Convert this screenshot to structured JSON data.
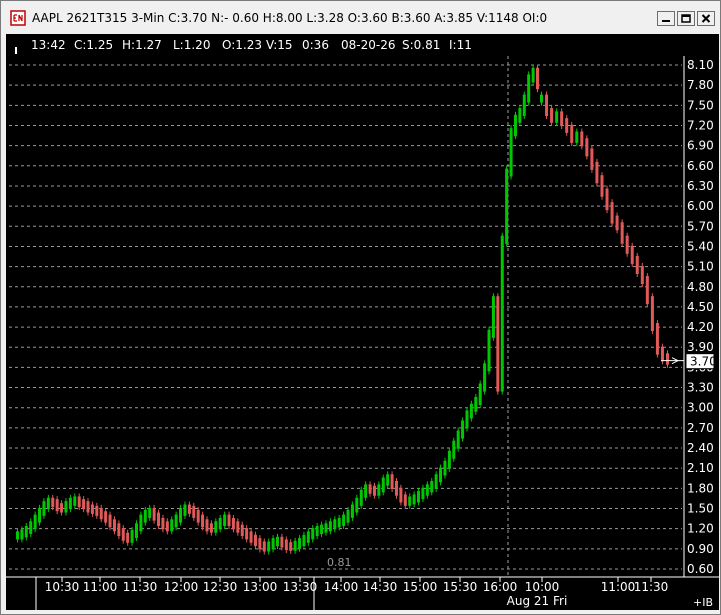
{
  "window": {
    "title": "AAPL 2621T315 3-Min C:3.70 N:- 0.60 H:8.00 L:3.28 O:3.60 B:3.60 A:3.85 V:1148 OI:0"
  },
  "infobar": {
    "time": "13:42",
    "close": "C:1.25",
    "high": "H:1.27",
    "low": "L:1.20",
    "open": "O:1.23",
    "volume": "V:15",
    "seconds": "0:36",
    "date": "08-20-26",
    "s": "S:0.81",
    "i": "I:11"
  },
  "chart_data": {
    "type": "candlestick",
    "y_ticks": [
      "8.10",
      "7.80",
      "7.50",
      "7.20",
      "6.90",
      "6.60",
      "6.30",
      "6.00",
      "5.70",
      "5.40",
      "5.10",
      "4.80",
      "4.50",
      "4.20",
      "3.90",
      "3.60",
      "3.30",
      "3.00",
      "2.70",
      "2.40",
      "2.10",
      "1.80",
      "1.50",
      "1.20",
      "0.90",
      "0.60"
    ],
    "ylim": [
      0.6,
      8.1
    ],
    "x_ticks": [
      "10:30",
      "11:00",
      "11:30",
      "12:00",
      "12:30",
      "13:00",
      "13:30",
      "14:00",
      "14:30",
      "15:00",
      "15:30",
      "16:00",
      "10:00",
      "11:00",
      "11:30"
    ],
    "day_label": "Aug 21 Fri",
    "last_price": "3.70",
    "cursor_value": "0.81",
    "footer_label": "+IB",
    "grid": true,
    "up_color": "#00c800",
    "down_color": "#e05a5a",
    "axis_text_color": "#ffffff",
    "grid_color": "#9a9a9a",
    "background_color": "#000000",
    "series": [
      {
        "session": "Aug 20",
        "values": [
          1.1,
          1.13,
          1.18,
          1.25,
          1.35,
          1.45,
          1.55,
          1.6,
          1.58,
          1.52,
          1.5,
          1.55,
          1.6,
          1.62,
          1.58,
          1.55,
          1.5,
          1.48,
          1.45,
          1.4,
          1.35,
          1.28,
          1.22,
          1.15,
          1.08,
          1.05,
          1.12,
          1.22,
          1.35,
          1.42,
          1.45,
          1.38,
          1.3,
          1.25,
          1.22,
          1.28,
          1.35,
          1.45,
          1.5,
          1.48,
          1.42,
          1.35,
          1.28,
          1.22,
          1.2,
          1.25,
          1.3,
          1.35,
          1.3,
          1.25,
          1.2,
          1.15,
          1.1,
          1.05,
          1.0,
          0.95,
          0.92,
          0.95,
          1.0,
          1.02,
          0.98,
          0.94,
          0.93,
          0.96,
          1.0,
          1.05,
          1.1,
          1.15,
          1.18,
          1.2,
          1.22,
          1.25,
          1.28,
          1.3,
          1.35,
          1.42,
          1.5,
          1.6,
          1.72,
          1.8,
          1.78,
          1.75,
          1.8,
          1.9,
          1.95,
          1.85,
          1.75,
          1.65,
          1.6,
          1.62,
          1.65,
          1.7,
          1.75,
          1.8,
          1.85,
          1.95,
          2.05,
          2.15,
          2.3,
          2.45,
          2.6,
          2.75,
          2.9,
          3.0,
          3.1,
          3.3,
          3.6,
          4.1,
          4.6,
          3.3,
          5.5,
          6.5,
          7.1,
          7.3,
          7.4,
          7.6,
          7.9,
          8.0,
          7.8
        ]
      },
      {
        "session": "Aug 21",
        "values": [
          7.6,
          7.4,
          7.3,
          7.35,
          7.25,
          7.15,
          7.0,
          7.05,
          6.95,
          6.8,
          6.6,
          6.4,
          6.2,
          6.0,
          5.8,
          5.7,
          5.5,
          5.35,
          5.2,
          5.05,
          4.9,
          4.6,
          4.2,
          3.85,
          3.75,
          3.7
        ]
      }
    ]
  }
}
